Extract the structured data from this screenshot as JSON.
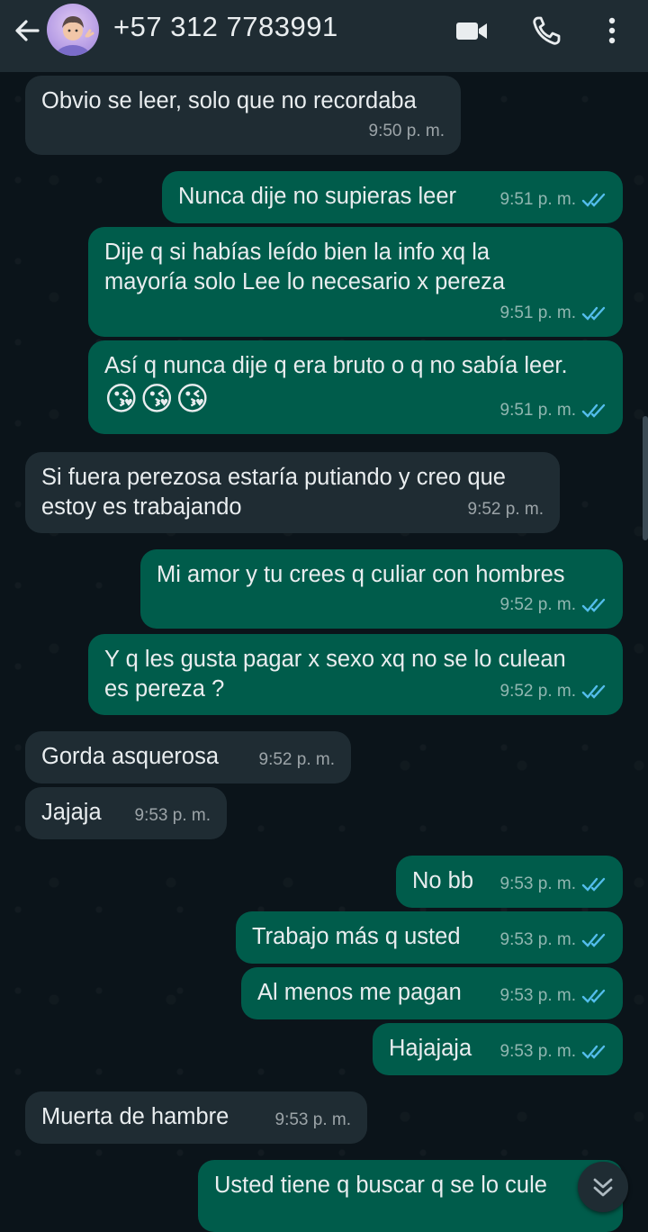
{
  "header": {
    "title": "+57 312 7783991",
    "icons": [
      "back-arrow-icon",
      "video-call-icon",
      "phone-icon",
      "more-vert-icon"
    ]
  },
  "colors": {
    "background": "#0b141a",
    "header": "#1f2c33",
    "incoming_bubble": "#1f2c33",
    "outgoing_bubble": "#005c4b",
    "read_ticks": "#53bdeb"
  },
  "messages": [
    {
      "dir": "in",
      "text": "Obvio se leer, solo que no recordaba",
      "time": "9:50 p. m."
    },
    {
      "dir": "out",
      "text": "Nunca dije no supieras leer",
      "time": "9:51 p. m."
    },
    {
      "dir": "out",
      "text": "Dije q si habías leído bien la info xq la\nmayoría solo Lee lo necesario x pereza",
      "time": "9:51 p. m."
    },
    {
      "dir": "out",
      "text": "Así q nunca dije q era bruto o q no sabía leer.",
      "emoji": "😘😘😘",
      "time": "9:51 p. m."
    },
    {
      "dir": "in",
      "text": "Si fuera perezosa estaría putiando y creo que\nestoy es trabajando",
      "time": "9:52 p. m."
    },
    {
      "dir": "out",
      "text": "Mi amor y tu crees q culiar con hombres",
      "time": "9:52 p. m."
    },
    {
      "dir": "out",
      "text": "Y q les gusta pagar x sexo xq no se lo culean\nes pereza ?",
      "time": "9:52 p. m."
    },
    {
      "dir": "in",
      "text": "Gorda asquerosa",
      "time": "9:52 p. m."
    },
    {
      "dir": "in",
      "text": "Jajaja",
      "time": "9:53 p. m."
    },
    {
      "dir": "out",
      "text": "No bb",
      "time": "9:53 p. m."
    },
    {
      "dir": "out",
      "text": "Trabajo más q usted",
      "time": "9:53 p. m."
    },
    {
      "dir": "out",
      "text": "Al menos me pagan",
      "time": "9:53 p. m."
    },
    {
      "dir": "out",
      "text": "Hajajaja",
      "time": "9:53 p. m."
    },
    {
      "dir": "in",
      "text": "Muerta de hambre",
      "time": "9:53 p. m."
    },
    {
      "dir": "out",
      "text": "Usted tiene q buscar q se lo cule",
      "time": ""
    }
  ],
  "scroll_button_icon": "chevrons-down-icon"
}
